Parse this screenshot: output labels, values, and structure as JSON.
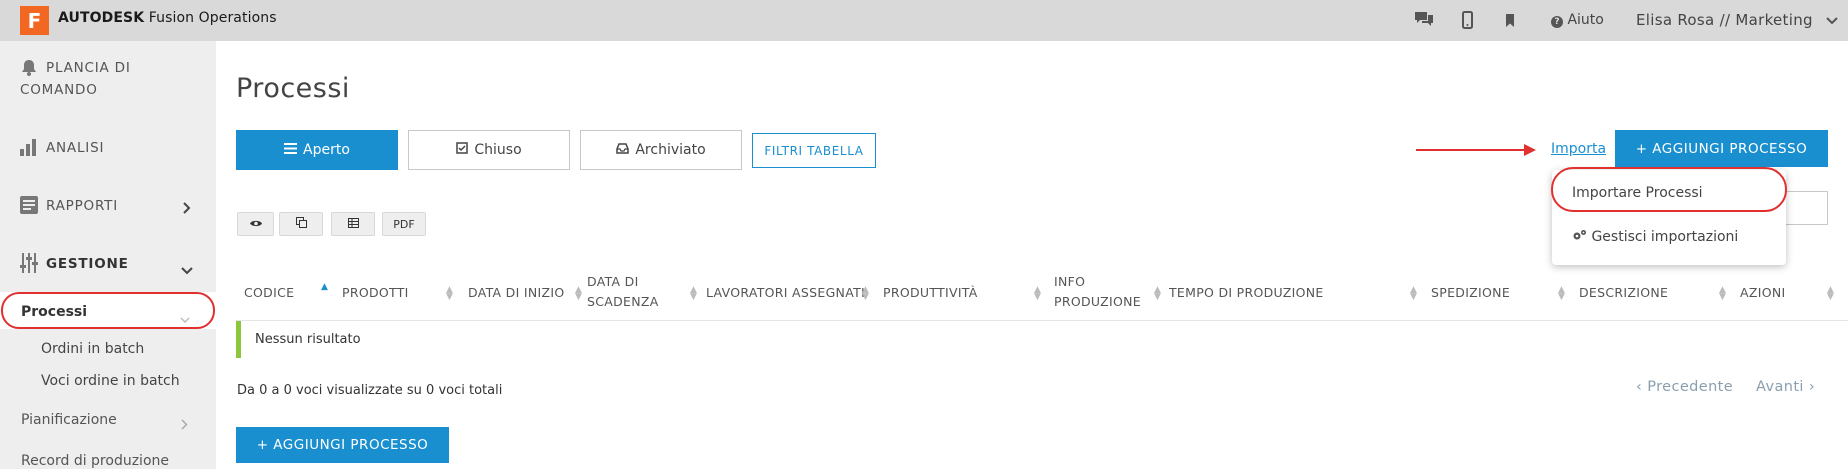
{
  "app": {
    "logo_letter": "F",
    "brand": "AUTODESK",
    "product": "Fusion Operations",
    "help_label": "Aiuto",
    "user_label": "Elisa Rosa // Marketing",
    "accent": "#1a8fd0",
    "logo_color": "#f26722"
  },
  "sidebar": {
    "dashboard_line1": "PLANCIA DI",
    "dashboard_line2": "COMANDO",
    "analisi": "ANALISI",
    "rapporti": "RAPPORTI",
    "gestione": "GESTIONE",
    "processi": "Processi",
    "ordini_batch": "Ordini in batch",
    "voci_ordine_batch": "Voci ordine in batch",
    "pianificazione": "Pianificazione",
    "record_produzione": "Record di produzione"
  },
  "page": {
    "title": "Processi",
    "tabs": [
      "Aperto",
      "Chiuso",
      "Archiviato"
    ],
    "filter_button": "FILTRI TABELLA",
    "import_link": "Importa",
    "add_button": "+ AGGIUNGI PROCESSO",
    "dropdown": {
      "item1": "Importare Processi",
      "item2": "Gestisci importazioni"
    },
    "tools": {
      "pdf": "PDF"
    }
  },
  "table": {
    "headers": {
      "codice": "CODICE",
      "prodotti": "PRODOTTI",
      "data_inizio": "DATA DI INIZIO",
      "data_scadenza_1": "DATA DI",
      "data_scadenza_2": "SCADENZA",
      "lavoratori": "LAVORATORI ASSEGNATI",
      "produttivita": "PRODUTTIVITÀ",
      "info_1": "INFO",
      "info_2": "PRODUZIONE",
      "tempo": "TEMPO DI PRODUZIONE",
      "spedizione": "SPEDIZIONE",
      "descrizione": "DESCRIZIONE",
      "azioni": "AZIONI"
    },
    "empty": "Nessun risultato",
    "info": "Da 0 a 0 voci visualizzate su 0 voci totali",
    "prev": "‹ Precedente",
    "next": "Avanti ›"
  }
}
